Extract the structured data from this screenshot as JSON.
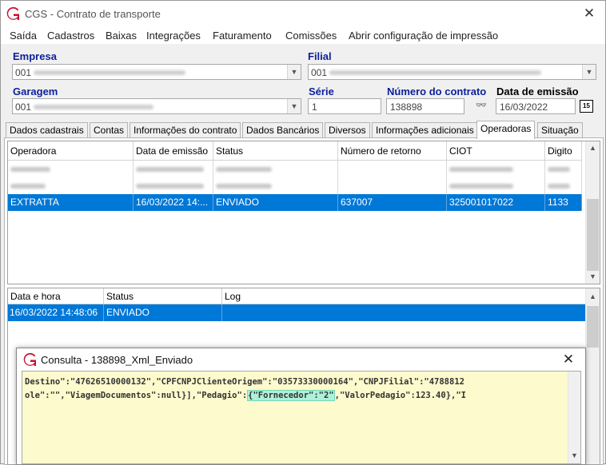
{
  "window": {
    "title": "CGS - Contrato de transporte"
  },
  "menu": [
    "Saída",
    "Cadastros",
    "Baixas",
    "Integrações",
    "Faturamento",
    "Comissões",
    "Abrir configuração de impressão"
  ],
  "form": {
    "empresa_label": "Empresa",
    "empresa_value": "001",
    "filial_label": "Filial",
    "filial_value": "001",
    "garagem_label": "Garagem",
    "garagem_value": "001",
    "serie_label": "Série",
    "serie_value": "1",
    "numero_label": "Número do contrato",
    "numero_value": "138898",
    "data_label": "Data de emissão",
    "data_value": "16/03/2022",
    "calendar_text": "15"
  },
  "tabs": [
    "Dados cadastrais",
    "Contas",
    "Informações do contrato",
    "Dados Bancários",
    "Diversos",
    "Informações adicionais",
    "Operadoras",
    "Situação"
  ],
  "active_tab": "Operadoras",
  "operadoras": {
    "columns": [
      "Operadora",
      "Data de emissão",
      "Status",
      "Número de retorno",
      "CIOT",
      "Digito"
    ],
    "selected_row": [
      "EXTRATTA",
      "16/03/2022 14:...",
      "ENVIADO",
      "637007",
      "325001017022",
      "1133"
    ]
  },
  "log": {
    "columns": [
      "Data e hora",
      "Status",
      "Log"
    ],
    "rows": [
      [
        "16/03/2022 14:48:06",
        "ENVIADO",
        ""
      ]
    ]
  },
  "dialog": {
    "title": "Consulta - 138898_Xml_Enviado",
    "line1": "Destino\":\"47626510000132\",\"CPFCNPJClienteOrigem\":\"03573330000164\",\"CNPJFilial\":\"4788812",
    "line2_a": "ole\":\"\",\"ViagemDocumentos\":null}],\"Pedagio\":",
    "line2_hl": "{\"Fornecedor\":\"2\"",
    "line2_b": ",\"ValorPedagio\":123.40},\"I"
  },
  "colors": {
    "selection": "#0078d7",
    "label_blue": "#0b1f9c",
    "code_bg": "#fdfacd",
    "highlight": "#aef0d8",
    "logo_red": "#c8102e"
  }
}
